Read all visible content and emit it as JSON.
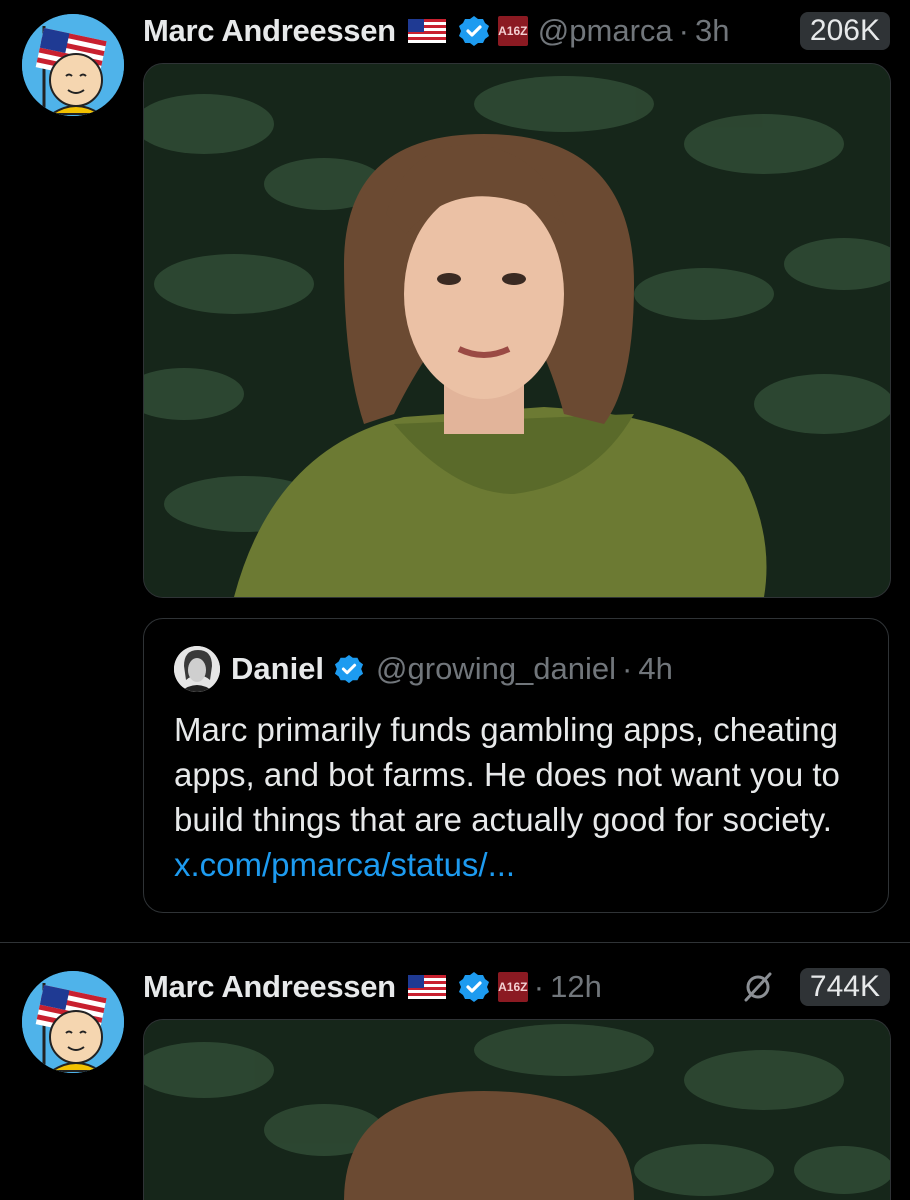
{
  "tweets": [
    {
      "author_name": "Marc Andreessen",
      "handle": "@pmarca",
      "separator": "·",
      "time": "3h",
      "views": "206K",
      "badge": "A16Z",
      "quoted": {
        "name": "Daniel",
        "handle": "@growing_daniel",
        "separator": "·",
        "time": "4h",
        "text": "Marc primarily funds gambling apps, cheating apps, and bot farms. He does not want you to build things that are actually good for society.",
        "link": "x.com/pmarca/status/..."
      }
    },
    {
      "author_name": "Marc Andreessen",
      "separator": "·",
      "time": "12h",
      "views": "744K",
      "badge": "A16Z"
    }
  ],
  "colors": {
    "background": "#000000",
    "text": "#e7e9ea",
    "muted": "#71767b",
    "verified": "#1d9bf0",
    "border": "#2f3336"
  },
  "icons": [
    "us-flag-icon",
    "verified-badge-icon",
    "a16z-badge-icon",
    "grok-slash-icon"
  ]
}
